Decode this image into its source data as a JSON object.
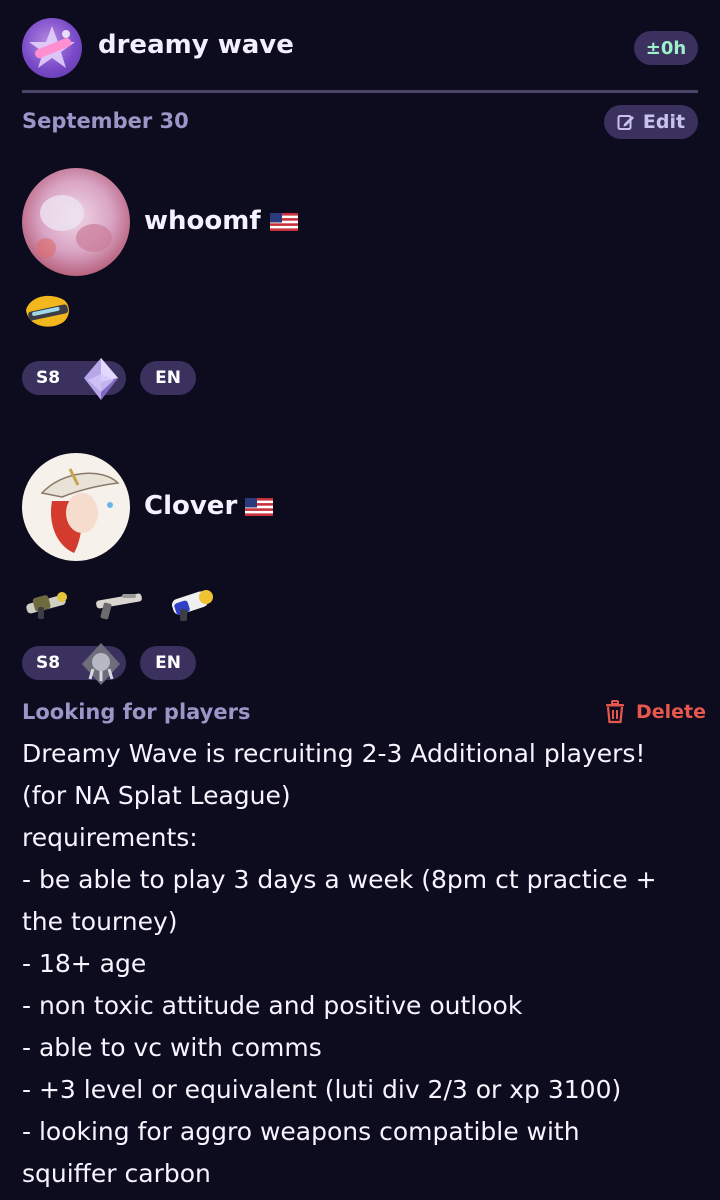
{
  "header": {
    "team_name": "dreamy wave",
    "timezone_badge": "±0h",
    "logo_icon": "dreamy-wave-logo"
  },
  "date_row": {
    "date": "September 30",
    "edit_label": "Edit"
  },
  "players": [
    {
      "name": "whoomf",
      "country_flag": "us-flag",
      "weapons": [
        "splat-roller-icon"
      ],
      "season": "S8",
      "language": "EN"
    },
    {
      "name": "Clover",
      "country_flag": "us-flag",
      "weapons": [
        "splattershot-icon",
        "charger-icon",
        "blaster-icon"
      ],
      "season": "S8",
      "language": "EN"
    }
  ],
  "post": {
    "type_label": "Looking for players",
    "delete_label": "Delete",
    "lines": [
      "Dreamy Wave is recruiting 2-3 Additional players!",
      "(for NA Splat League)",
      "requirements:",
      "- be able to play 3 days a week (8pm ct practice +",
      "the tourney)",
      "- 18+ age",
      "- non toxic attitude and positive outlook",
      "- able to vc with comms",
      "- +3 level or equivalent (luti div 2/3 or xp 3100)",
      "- looking for aggro weapons compatible with",
      "squiffer carbon"
    ]
  },
  "colors": {
    "background": "#0d0b1e",
    "badge_bg": "#3a315f",
    "muted_text": "#9c95c7",
    "timezone_green": "#9ef0c9",
    "delete_red": "#e8574e"
  }
}
